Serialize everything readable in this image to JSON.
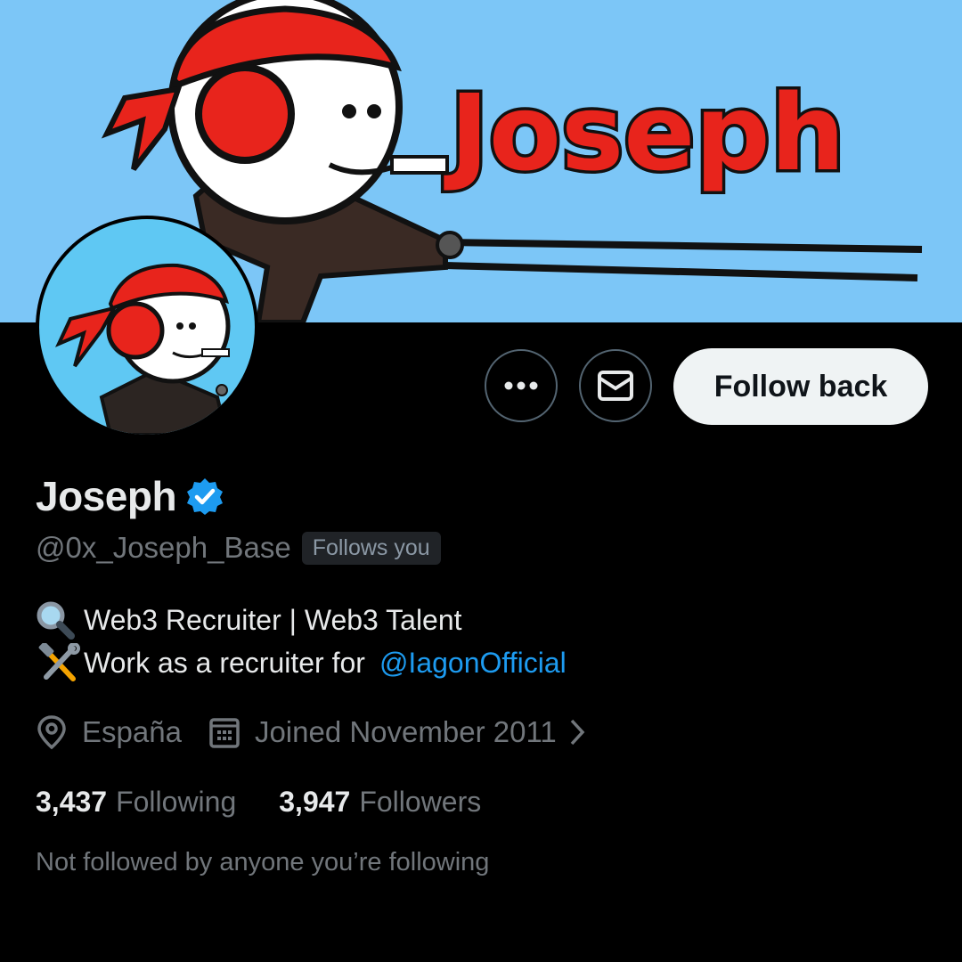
{
  "banner": {
    "text": "Joseph",
    "bg_color": "#7cc6f7",
    "text_color": "#e8241c"
  },
  "actions": {
    "more_icon": "more-horizontal-icon",
    "message_icon": "envelope-icon",
    "follow_label": "Follow back"
  },
  "profile": {
    "display_name": "Joseph",
    "verified_icon": "verified-badge-icon",
    "verified_color": "#1d9bf0",
    "handle": "@0x_Joseph_Base",
    "follows_you": "Follows you"
  },
  "bio": {
    "line1_icon": "magnifying-glass-emoji",
    "line1": "Web3 Recruiter | Web3 Talent",
    "line2_icon": "hammer-and-wrench-emoji",
    "line2": "Work as a recruiter for",
    "mention": "@IagonOfficial"
  },
  "meta": {
    "location_icon": "location-pin-icon",
    "location": "España",
    "joined_icon": "calendar-icon",
    "joined": "Joined November 2011",
    "chevron_icon": "chevron-right-icon"
  },
  "stats": {
    "following_count": "3,437",
    "following_label": "Following",
    "followers_count": "3,947",
    "followers_label": "Followers"
  },
  "note": "Not followed by anyone you’re following"
}
